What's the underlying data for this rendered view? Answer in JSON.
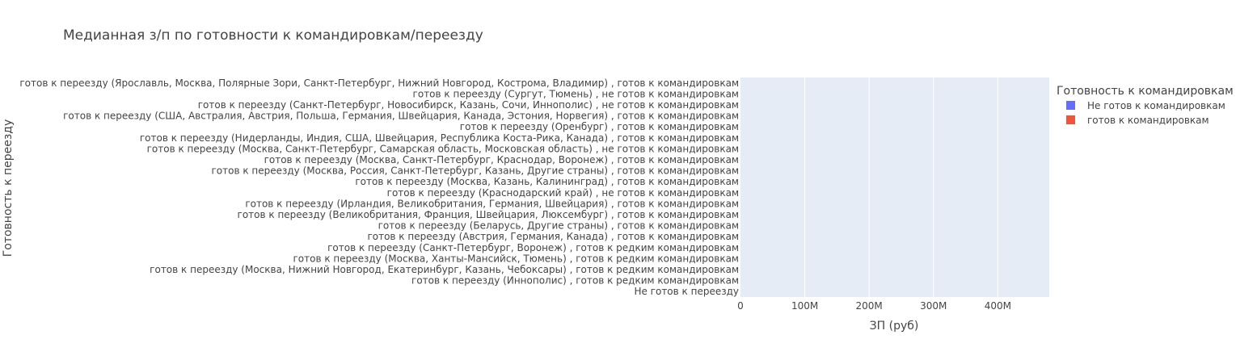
{
  "chart_data": {
    "type": "bar",
    "orientation": "horizontal",
    "title": "Медианная з/п по готовности к командировкам/переезду",
    "xlabel": "ЗП (руб)",
    "ylabel": "Готовность к переезду",
    "xlim": [
      0,
      480000000
    ],
    "x_ticks": [
      {
        "value": 0,
        "label": "0"
      },
      {
        "value": 100000000,
        "label": "100M"
      },
      {
        "value": 200000000,
        "label": "200M"
      },
      {
        "value": 300000000,
        "label": "300M"
      },
      {
        "value": 400000000,
        "label": "400M"
      }
    ],
    "grid": true,
    "legend": {
      "title": "Готовность к командировкам",
      "position": "right"
    },
    "categories": [
      "готов к переезду (Ярославль, Москва, Полярные Зори, Санкт-Петербург, Нижний Новгород, Кострома, Владимир) , готов к командировкам",
      "готов к переезду (Сургут, Тюмень) , не готов к командировкам",
      "готов к переезду (Санкт-Петербург, Новосибирск, Казань, Сочи, Иннополис) , не готов к командировкам",
      "готов к переезду (США, Австралия, Австрия, Польша, Германия, Швейцария, Канада, Эстония, Норвегия) , готов к командировкам",
      "готов к переезду (Оренбург) , готов к командировкам",
      "готов к переезду (Нидерланды, Индия, США, Швейцария, Республика Коста-Рика, Канада) , готов к командировкам",
      "готов к переезду (Москва, Санкт-Петербург, Самарская область, Московская область) , не готов к командировкам",
      "готов к переезду (Москва, Санкт-Петербург, Краснодар, Воронеж) , готов к командировкам",
      "готов к переезду (Москва, Россия, Санкт-Петербург, Казань, Другие страны) , готов к командировкам",
      "готов к переезду (Москва, Казань, Калининград) , готов к командировкам",
      "готов к переезду (Краснодарский край) , не готов к командировкам",
      "готов к переезду (Ирландия, Великобритания, Германия, Швейцария) , готов к командировкам",
      "готов к переезду (Великобритания, Франция, Швейцария, Люксембург) , готов к командировкам",
      "готов к переезду (Беларусь, Другие страны) , готов к командировкам",
      "готов к переезду (Австрия, Германия, Канада) , готов к командировкам",
      "готов к переезду (Санкт-Петербург, Воронеж) , готов к редким командировкам",
      "готов к переезду (Москва, Ханты-Мансийск, Тюмень) , готов к редким командировкам",
      "готов к переезду (Москва, Нижний Новгород, Екатеринбург, Казань, Чебоксары) , готов к редким командировкам",
      "готов к переезду (Иннополис) , готов к редким командировкам",
      "Не готов к переезду"
    ],
    "series": [
      {
        "name": "Не готов к командировкам",
        "color": "#636efa",
        "values": [
          0,
          0,
          0,
          0,
          0,
          0,
          0,
          0,
          0,
          0,
          0,
          0,
          0,
          0,
          0,
          0,
          0,
          0,
          0,
          0
        ]
      },
      {
        "name": "готов к командировкам",
        "color": "#ef553b",
        "values": [
          0,
          0,
          0,
          0,
          0,
          0,
          0,
          0,
          0,
          0,
          0,
          0,
          0,
          0,
          0,
          0,
          0,
          0,
          0,
          0
        ]
      }
    ]
  }
}
